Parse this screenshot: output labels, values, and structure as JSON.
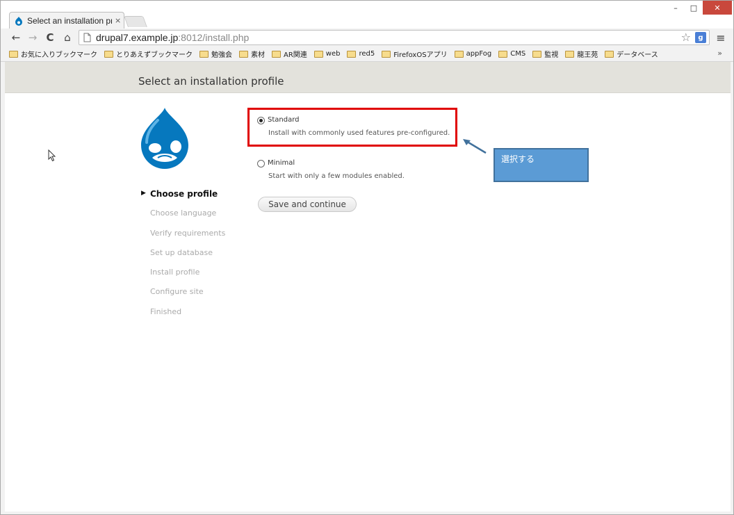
{
  "browser": {
    "tab_title": "Select an installation pr",
    "tab_close": "×",
    "url_host": "drupal7.example.jp",
    "url_rest": ":8012/install.php",
    "window_controls": {
      "minimize": "–",
      "maximize": "□",
      "close": "✕"
    },
    "nav": {
      "back": "←",
      "forward": "→",
      "reload": "C",
      "home": "⌂"
    },
    "star": "☆",
    "extension": "g",
    "menu": "≡",
    "bookmarks": [
      "お気に入りブックマーク",
      "とりあえずブックマーク",
      "勉強会",
      "素材",
      "AR関連",
      "web",
      "red5",
      "FirefoxOSアプリ",
      "appFog",
      "CMS",
      "監視",
      "龍王苑",
      "データベース"
    ],
    "bookmarks_more": "»"
  },
  "page": {
    "title": "Select an installation profile",
    "steps": [
      {
        "label": "Choose profile",
        "active": true
      },
      {
        "label": "Choose language",
        "active": false
      },
      {
        "label": "Verify requirements",
        "active": false
      },
      {
        "label": "Set up database",
        "active": false
      },
      {
        "label": "Install profile",
        "active": false
      },
      {
        "label": "Configure site",
        "active": false
      },
      {
        "label": "Finished",
        "active": false
      }
    ],
    "options": [
      {
        "label": "Standard",
        "description": "Install with commonly used features pre-configured.",
        "checked": true
      },
      {
        "label": "Minimal",
        "description": "Start with only a few modules enabled.",
        "checked": false
      }
    ],
    "save_button": "Save and continue"
  },
  "annotation": {
    "callout_text": "選択する",
    "box_color": "#e00000",
    "callout_color": "#5b9bd5"
  },
  "colors": {
    "drupal_blue": "#0678be",
    "header_band": "#e3e2dc"
  }
}
